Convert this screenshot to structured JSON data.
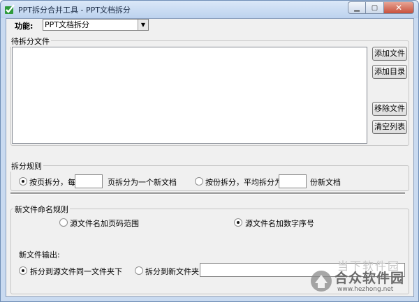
{
  "window": {
    "title": "PPT拆分合并工具 - PPT文档拆分"
  },
  "function_row": {
    "label": "功能:",
    "selected": "PPT文档拆分"
  },
  "files_group": {
    "title": "待拆分文件",
    "add_file": "添加文件",
    "add_dir": "添加目录",
    "remove_file": "移除文件",
    "clear_list": "清空列表"
  },
  "split_rules": {
    "title": "拆分规则",
    "by_page_label": "按页拆分，每",
    "by_page_suffix": "页拆分为一个新文档",
    "by_page_value": "",
    "by_count_label": "按份拆分，平均拆分为",
    "by_count_suffix": "份新文档",
    "by_count_value": ""
  },
  "naming": {
    "title": "新文件命名规则",
    "opt_page_range": "源文件名加页码范围",
    "opt_number": "源文件名加数字序号",
    "output_label": "新文件输出:",
    "out_same": "拆分到源文件同一文件夹下",
    "out_new": "拆分到新文件夹:",
    "out_path_value": ""
  },
  "watermark": {
    "title": "合众软件园",
    "ghost": "当下软件园",
    "url": "www.hezhong.net"
  },
  "colors": {
    "title_bar": "#bcd2ee",
    "close_button": "#c8503c",
    "client_bg": "#f0f0f0"
  }
}
